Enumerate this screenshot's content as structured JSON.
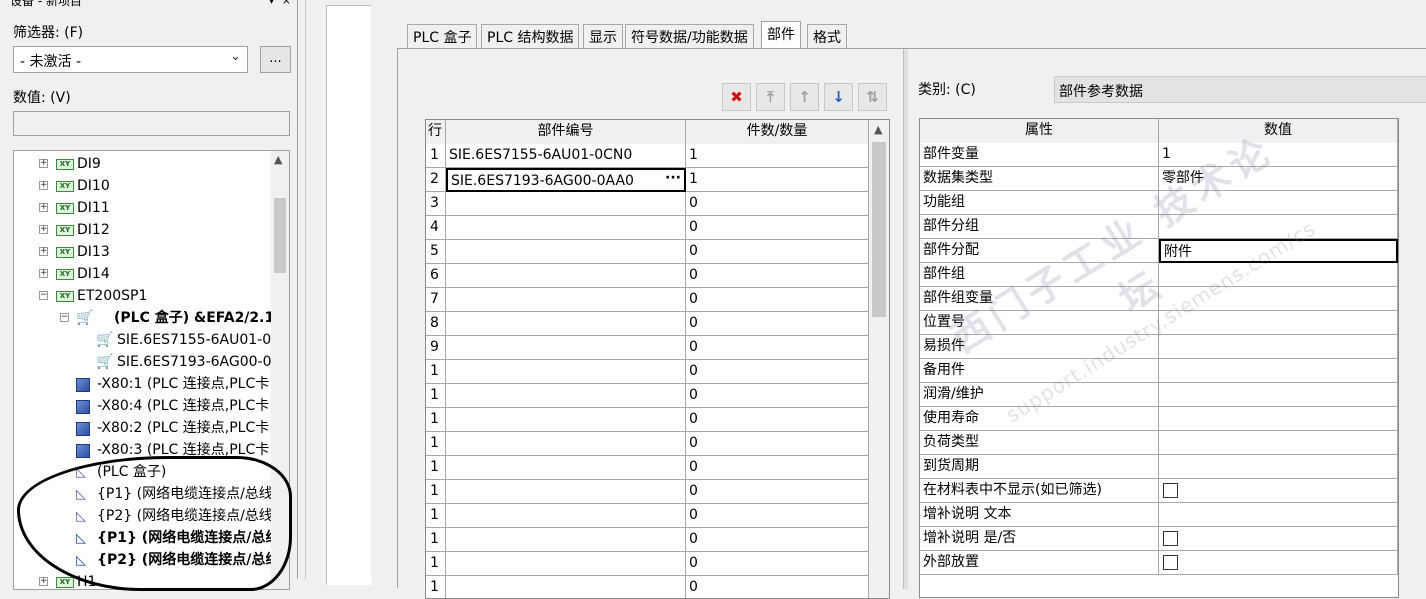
{
  "left_panel": {
    "title": "设备 - 新项目",
    "title_buttons": "▾ ×",
    "filter_label": "筛选器: (F)",
    "filter_value": "- 未激活 -",
    "filter_more": "...",
    "value_label": "数值: (V)",
    "value_field": "",
    "tree": [
      {
        "text": "DI9",
        "icon": "xy-device-icon",
        "expander": "+",
        "bold": false
      },
      {
        "text": "DI10",
        "icon": "xy-device-icon",
        "expander": "+",
        "bold": false
      },
      {
        "text": "DI11",
        "icon": "xy-device-icon",
        "expander": "+",
        "bold": false
      },
      {
        "text": "DI12",
        "icon": "xy-device-icon",
        "expander": "+",
        "bold": false
      },
      {
        "text": "DI13",
        "icon": "xy-device-icon",
        "expander": "+",
        "bold": false
      },
      {
        "text": "DI14",
        "icon": "xy-device-icon",
        "expander": "+",
        "bold": false
      },
      {
        "text": "ET200SP1",
        "icon": "xy-device-icon",
        "expander": "−",
        "bold": false
      },
      {
        "text": "(PLC 盒子) &EFA2/2.1",
        "icon": "plc-box-cart-icon",
        "expander": "−",
        "bold": true
      },
      {
        "text": "SIE.6ES7155-6AU01-0",
        "icon": "cart-icon",
        "expander": "",
        "bold": false
      },
      {
        "text": "SIE.6ES7193-6AG00-0",
        "icon": "cart-icon",
        "expander": "",
        "bold": false
      },
      {
        "text": "-X80:1 (PLC 连接点,PLC卡",
        "icon": "plc-connector-icon",
        "expander": "",
        "bold": false
      },
      {
        "text": "-X80:4 (PLC 连接点,PLC卡",
        "icon": "plc-connector-icon",
        "expander": "",
        "bold": false
      },
      {
        "text": "-X80:2 (PLC 连接点,PLC卡",
        "icon": "plc-connector-icon",
        "expander": "",
        "bold": false
      },
      {
        "text": "-X80:3 (PLC 连接点,PLC卡",
        "icon": "plc-connector-icon",
        "expander": "",
        "bold": false
      },
      {
        "text": "(PLC 盒子)",
        "icon": "triangle-icon",
        "expander": "",
        "bold": false
      },
      {
        "text": "{P1} (网络电缆连接点/总线",
        "icon": "network-point-icon",
        "expander": "",
        "bold": false
      },
      {
        "text": "{P2} (网络电缆连接点/总线",
        "icon": "network-point-icon",
        "expander": "",
        "bold": false
      },
      {
        "text": "{P1} (网络电缆连接点/总线",
        "icon": "network-point-blue-icon",
        "expander": "",
        "bold": true
      },
      {
        "text": "{P2} (网络电缆连接点/总线",
        "icon": "network-point-blue-icon",
        "expander": "",
        "bold": true
      },
      {
        "text": "H1",
        "icon": "xy-device-icon",
        "expander": "+",
        "bold": false
      }
    ]
  },
  "dialog": {
    "tabs": [
      "PLC 盒子",
      "PLC 结构数据",
      "显示",
      "符号数据/功能数据",
      "部件",
      "格式"
    ],
    "active_tab": 4,
    "toolbar": {
      "delete": "✖",
      "top": "⤒",
      "up": "↑",
      "down": "↓",
      "sort": "⇅"
    },
    "parts_table": {
      "headers": [
        "行",
        "部件编号",
        "件数/数量"
      ],
      "rows": [
        {
          "n": "1",
          "part": "SIE.6ES7155-6AU01-0CN0",
          "qty": "1"
        },
        {
          "n": "2",
          "part": "SIE.6ES7193-6AG00-0AA0",
          "qty": "1"
        },
        {
          "n": "3",
          "part": "",
          "qty": "0"
        },
        {
          "n": "4",
          "part": "",
          "qty": "0"
        },
        {
          "n": "5",
          "part": "",
          "qty": "0"
        },
        {
          "n": "6",
          "part": "",
          "qty": "0"
        },
        {
          "n": "7",
          "part": "",
          "qty": "0"
        },
        {
          "n": "8",
          "part": "",
          "qty": "0"
        },
        {
          "n": "9",
          "part": "",
          "qty": "0"
        },
        {
          "n": "1",
          "part": "",
          "qty": "0"
        },
        {
          "n": "1",
          "part": "",
          "qty": "0"
        },
        {
          "n": "1",
          "part": "",
          "qty": "0"
        },
        {
          "n": "1",
          "part": "",
          "qty": "0"
        },
        {
          "n": "1",
          "part": "",
          "qty": "0"
        },
        {
          "n": "1",
          "part": "",
          "qty": "0"
        },
        {
          "n": "1",
          "part": "",
          "qty": "0"
        },
        {
          "n": "1",
          "part": "",
          "qty": "0"
        },
        {
          "n": "1",
          "part": "",
          "qty": "0"
        },
        {
          "n": "1",
          "part": "",
          "qty": "0"
        }
      ],
      "editing_row": 1,
      "ellipsis": "···"
    },
    "category_label": "类别: (C)",
    "category_value": "部件参考数据",
    "props_table": {
      "headers": [
        "属性",
        "数值"
      ],
      "rows": [
        {
          "name": "部件变量",
          "value": "1",
          "checkbox": false
        },
        {
          "name": "数据集类型",
          "value": "零部件",
          "checkbox": false
        },
        {
          "name": "功能组",
          "value": "",
          "checkbox": false
        },
        {
          "name": "部件分组",
          "value": "",
          "checkbox": false
        },
        {
          "name": "部件分配",
          "value": "附件",
          "checkbox": false,
          "selected": true
        },
        {
          "name": "部件组",
          "value": "",
          "checkbox": false
        },
        {
          "name": "部件组变量",
          "value": "",
          "checkbox": false
        },
        {
          "name": "位置号",
          "value": "",
          "checkbox": false
        },
        {
          "name": "易损件",
          "value": "",
          "checkbox": false
        },
        {
          "name": "备用件",
          "value": "",
          "checkbox": false
        },
        {
          "name": "润滑/维护",
          "value": "",
          "checkbox": false
        },
        {
          "name": "使用寿命",
          "value": "",
          "checkbox": false
        },
        {
          "name": "负荷类型",
          "value": "",
          "checkbox": false
        },
        {
          "name": "到货周期",
          "value": "",
          "checkbox": false
        },
        {
          "name": "在材料表中不显示(如已筛选)",
          "value": "",
          "checkbox": true
        },
        {
          "name": "增补说明 文本",
          "value": "",
          "checkbox": false
        },
        {
          "name": "增补说明 是/否",
          "value": "",
          "checkbox": true
        },
        {
          "name": "外部放置",
          "value": "",
          "checkbox": true
        }
      ]
    }
  },
  "watermark": {
    "cn": "西门子工业 技术论坛",
    "en": "support.industry.siemens.com/cs"
  },
  "colors": {
    "delete_red": "#d01010",
    "arrow_blue": "#1f5fbf",
    "disabled_gray": "#a0a0a0",
    "xy_green": "#3a8a3a"
  }
}
